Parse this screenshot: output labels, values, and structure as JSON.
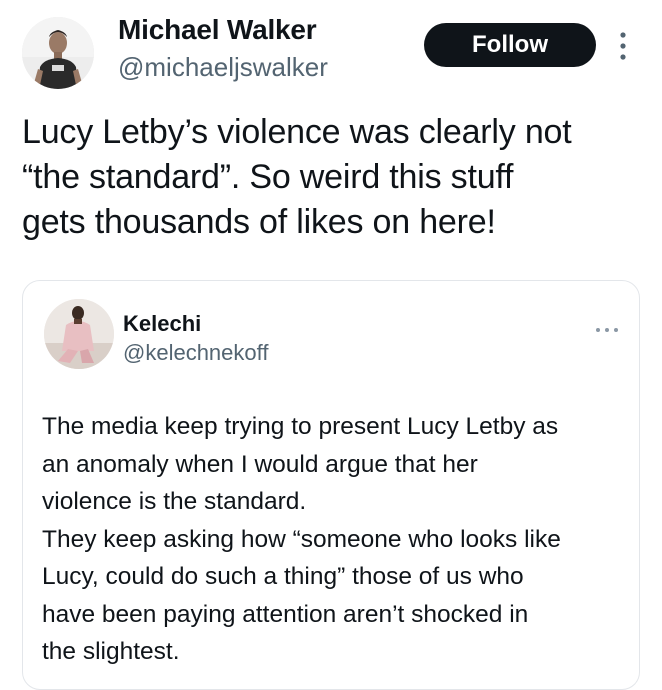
{
  "post": {
    "author": {
      "name": "Michael Walker",
      "handle": "@michaeljswalker",
      "avatar_icon": "user-avatar-photo"
    },
    "follow_label": "Follow",
    "more_icon": "more-vertical-icon",
    "text": "Lucy Letby’s violence was clearly not\n“the standard”. So weird this stuff\ngets thousands of likes on here!"
  },
  "quoted_post": {
    "author": {
      "name": "Kelechi",
      "handle": "@kelechnekoff",
      "avatar_icon": "user-avatar-photo"
    },
    "more_icon": "more-horizontal-icon",
    "text": "The media keep trying to present Lucy Letby as\nan anomaly when I would argue that her\nviolence is the standard.\nThey keep asking how “someone who looks like\nLucy, could do such a thing” those of us who\nhave been paying attention aren’t shocked in\nthe slightest."
  },
  "colors": {
    "text": "#0f1419",
    "secondary_text": "#536471",
    "follow_button_bg": "#0f1419",
    "border": "#e3e6ea"
  }
}
